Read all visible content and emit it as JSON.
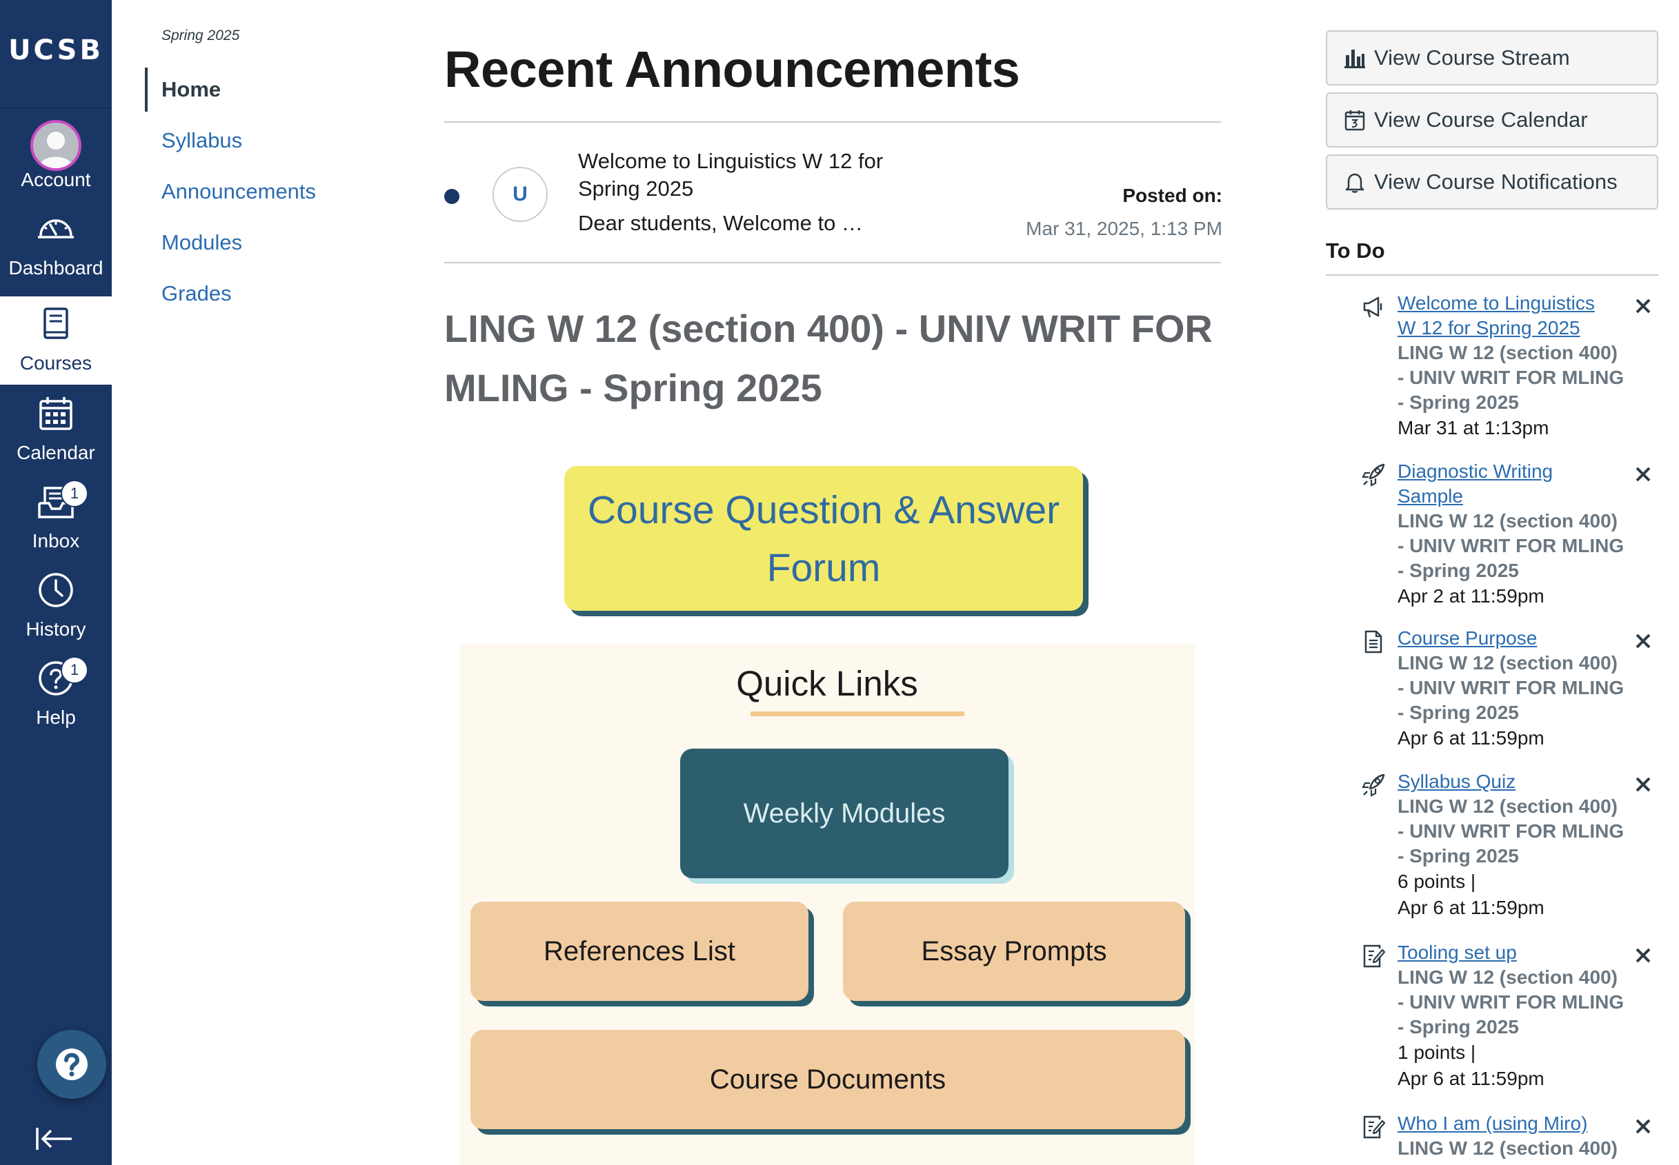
{
  "global_nav": {
    "logo": "UCSB",
    "items": [
      {
        "label": "Account"
      },
      {
        "label": "Dashboard"
      },
      {
        "label": "Courses"
      },
      {
        "label": "Calendar"
      },
      {
        "label": "Inbox",
        "badge": "1"
      },
      {
        "label": "History"
      },
      {
        "label": "Help",
        "badge": "1"
      }
    ]
  },
  "course_nav": {
    "term": "Spring 2025",
    "items": [
      {
        "label": "Home"
      },
      {
        "label": "Syllabus"
      },
      {
        "label": "Announcements"
      },
      {
        "label": "Modules"
      },
      {
        "label": "Grades"
      }
    ]
  },
  "main": {
    "title": "Recent Announcements",
    "announcement": {
      "avatar_letter": "U",
      "title": "Welcome to Linguistics W 12 for Spring 2025",
      "snippet": "Dear students, Welcome to …",
      "posted_label": "Posted on:",
      "posted_date": "Mar 31, 2025, 1:13 PM"
    },
    "course_title": "LING W 12 (section 400) - UNIV WRIT FOR MLING - Spring 2025",
    "qa_button": "Course Question & Answer Forum",
    "quick_links": {
      "title": "Quick Links",
      "weekly_modules": "Weekly Modules",
      "references": "References List",
      "essay_prompts": "Essay Prompts",
      "course_documents": "Course Documents"
    }
  },
  "right_side": {
    "buttons": [
      {
        "label": "View Course Stream",
        "icon": "bar-chart-icon"
      },
      {
        "label": "View Course Calendar",
        "icon": "calendar-icon"
      },
      {
        "label": "View Course Notifications",
        "icon": "bell-icon"
      }
    ],
    "todo_header": "To Do",
    "todos": [
      {
        "icon": "megaphone-icon",
        "title": "Welcome to Linguistics W 12 for Spring 2025",
        "course": "LING W 12 (section 400) - UNIV WRIT FOR MLING - Spring 2025",
        "meta": [
          "Mar 31 at 1:13pm"
        ]
      },
      {
        "icon": "rocket-icon",
        "title": "Diagnostic Writing Sample",
        "course": "LING W 12 (section 400) - UNIV WRIT FOR MLING - Spring 2025",
        "meta": [
          "Apr 2 at 11:59pm"
        ]
      },
      {
        "icon": "document-icon",
        "title": "Course Purpose",
        "course": "LING W 12 (section 400) - UNIV WRIT FOR MLING - Spring 2025",
        "meta": [
          "Apr 6 at 11:59pm"
        ]
      },
      {
        "icon": "rocket-icon",
        "title": "Syllabus Quiz",
        "course": "LING W 12 (section 400) - UNIV WRIT FOR MLING - Spring 2025",
        "meta": [
          "6 points  |",
          "Apr 6 at 11:59pm"
        ]
      },
      {
        "icon": "assignment-icon",
        "title": "Tooling set up",
        "course": "LING W 12 (section 400) - UNIV WRIT FOR MLING - Spring 2025",
        "meta": [
          "1 points  |",
          "Apr 6 at 11:59pm"
        ]
      },
      {
        "icon": "assignment-icon",
        "title": "Who I am (using Miro)",
        "course": "LING W 12 (section 400)",
        "meta": []
      }
    ]
  }
}
